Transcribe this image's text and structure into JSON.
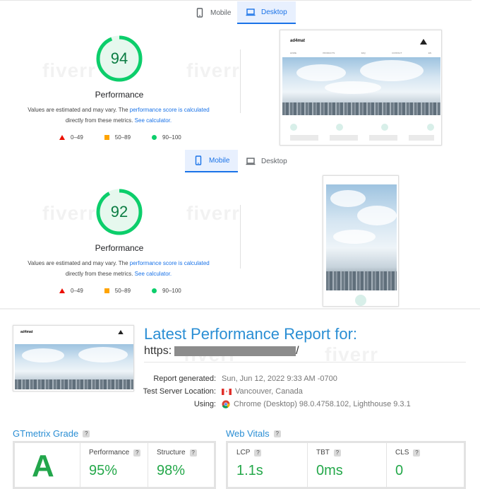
{
  "watermark": "fiverr",
  "desktop_panel": {
    "tabs": {
      "mobile": "Mobile",
      "desktop": "Desktop",
      "active": "desktop"
    },
    "score": "94",
    "score_fraction": 0.94,
    "score_label": "Performance",
    "note_pre": "Values are estimated and may vary. The ",
    "note_link": "performance score is calculated",
    "note_mid": "directly from these metrics. ",
    "note_link2": "See calculator.",
    "legend": {
      "low": "0–49",
      "mid": "50–89",
      "high": "90–100"
    },
    "preview": {
      "brand": "ad4mat",
      "nav": [
        "HOME",
        "PRODUCTS",
        "FAQ",
        "CONTACT",
        "EN"
      ]
    }
  },
  "mobile_panel": {
    "tabs": {
      "mobile": "Mobile",
      "desktop": "Desktop",
      "active": "mobile"
    },
    "score": "92",
    "score_fraction": 0.92,
    "score_label": "Performance",
    "note_pre": "Values are estimated and may vary. The ",
    "note_link": "performance score is calculated",
    "note_mid": "directly from these metrics. ",
    "note_link2": "See calculator.",
    "legend": {
      "low": "0–49",
      "mid": "50–89",
      "high": "90–100"
    }
  },
  "gtmetrix": {
    "thumb_brand": "ad4mat",
    "title": "Latest Performance Report for:",
    "url_prefix": "https:",
    "url_suffix": "/",
    "report_generated_label": "Report generated:",
    "report_generated_value": "Sun, Jun 12, 2022 9:33 AM -0700",
    "server_label": "Test Server Location:",
    "server_value": "Vancouver, Canada",
    "using_label": "Using:",
    "using_value": "Chrome (Desktop) 98.0.4758.102, Lighthouse 9.3.1",
    "grade_title": "GTmetrix Grade",
    "grade": "A",
    "performance_label": "Performance",
    "performance_value": "95%",
    "structure_label": "Structure",
    "structure_value": "98%",
    "vitals_title": "Web Vitals",
    "lcp_label": "LCP",
    "lcp_value": "1.1s",
    "tbt_label": "TBT",
    "tbt_value": "0ms",
    "cls_label": "CLS",
    "cls_value": "0",
    "help": "?"
  },
  "colors": {
    "accent": "#1a73e8",
    "pass": "#0cce6b",
    "gt_blue": "#2a8ed4",
    "gt_green": "#24a84a"
  }
}
